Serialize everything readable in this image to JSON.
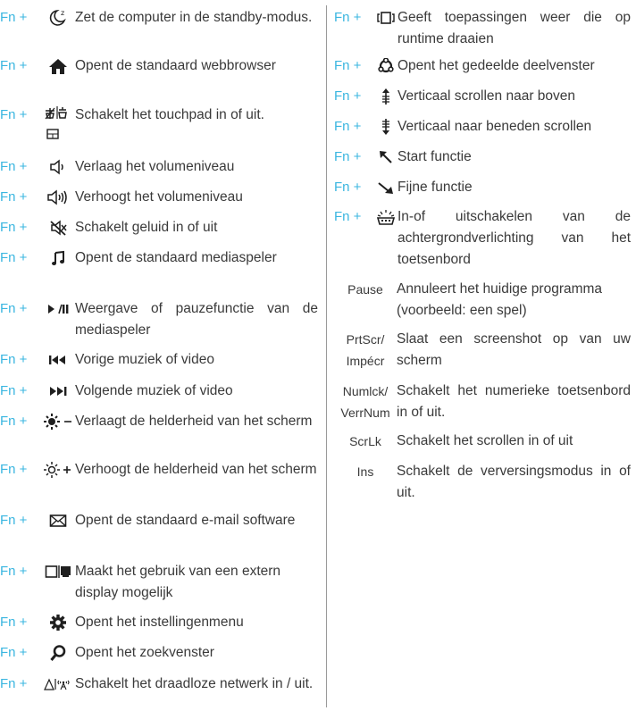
{
  "left": [
    {
      "fn": "Fn +",
      "icon": "moon-zz-icon",
      "desc": "Zet de computer in de standby-modus."
    },
    {
      "fn": "Fn +",
      "icon": "home-icon",
      "desc": "Opent de standaard webbrowser"
    },
    {
      "fn": "Fn +",
      "icon": "touchpad-icon",
      "desc": "Schakelt het touchpad in of uit."
    },
    {
      "fn": "Fn +",
      "icon": "volume-down-icon",
      "desc": "Verlaag het volumeniveau"
    },
    {
      "fn": "Fn +",
      "icon": "volume-up-icon",
      "desc": "Verhoogt het volumeniveau"
    },
    {
      "fn": "Fn +",
      "icon": "mute-icon",
      "desc": "Schakelt geluid in of uit"
    },
    {
      "fn": "Fn +",
      "icon": "music-note-icon",
      "desc": "Opent de standaard mediaspeler"
    },
    {
      "fn": "Fn +",
      "icon": "play-pause-icon",
      "desc": "Weergave of pauzefunctie van de mediaspeler"
    },
    {
      "fn": "Fn +",
      "icon": "previous-track-icon",
      "desc": "Vorige muziek of video"
    },
    {
      "fn": "Fn +",
      "icon": "next-track-icon",
      "desc": "Volgende muziek of video"
    },
    {
      "fn": "Fn +",
      "icon": "brightness-down-icon",
      "desc": "Verlaagt de helderheid van het scherm"
    },
    {
      "fn": "Fn +",
      "icon": "brightness-up-icon",
      "desc": "Verhoogt de helderheid van het scherm"
    },
    {
      "fn": "Fn +",
      "icon": "email-icon",
      "desc": "Opent de standaard e-mail software"
    },
    {
      "fn": "Fn +",
      "icon": "external-display-icon",
      "desc": "Maakt het gebruik van een extern display mogelijk"
    },
    {
      "fn": "Fn +",
      "icon": "gear-icon",
      "desc": "Opent het instellingenmenu"
    },
    {
      "fn": "Fn +",
      "icon": "search-icon",
      "desc": "Opent het zoekvenster"
    },
    {
      "fn": "Fn +",
      "icon": "wireless-icon",
      "desc": "Schakelt het draadloze netwerk in / uit."
    }
  ],
  "right": [
    {
      "fn": "Fn +",
      "icon": "running-apps-icon",
      "desc": "Geeft toepassingen weer die op runtime draaien"
    },
    {
      "fn": "Fn +",
      "icon": "share-icon",
      "desc": "Opent het gedeelde deelvenster"
    },
    {
      "fn": "Fn +",
      "icon": "scroll-up-icon",
      "desc": "Verticaal scrollen naar boven"
    },
    {
      "fn": "Fn +",
      "icon": "scroll-down-icon",
      "desc": "Verticaal naar beneden scrollen"
    },
    {
      "fn": "Fn +",
      "icon": "arrow-up-left-icon",
      "desc": "Start functie"
    },
    {
      "fn": "Fn +",
      "icon": "arrow-down-right-icon",
      "desc": "Fijne functie"
    },
    {
      "fn": "Fn +",
      "icon": "keyboard-backlight-icon",
      "desc": "In-of uitschakelen van de achtergrondverlichting van het toetsenbord"
    }
  ],
  "keys": [
    {
      "key": "Pause",
      "key2": "",
      "desc": "Annuleert het huidige programma (voorbeeld: een spel)"
    },
    {
      "key": "PrtScr/",
      "key2": "Impécr",
      "desc": "Slaat een screenshot op van uw scherm"
    },
    {
      "key": "Numlck/",
      "key2": "VerrNum",
      "desc": "Schakelt het numerieke toetsenbord in of uit."
    },
    {
      "key": "ScrLk",
      "key2": "",
      "desc": "Schakelt het scrollen in of uit"
    },
    {
      "key": "Ins",
      "key2": "",
      "desc": "Schakelt de verversingsmodus in of uit."
    }
  ]
}
